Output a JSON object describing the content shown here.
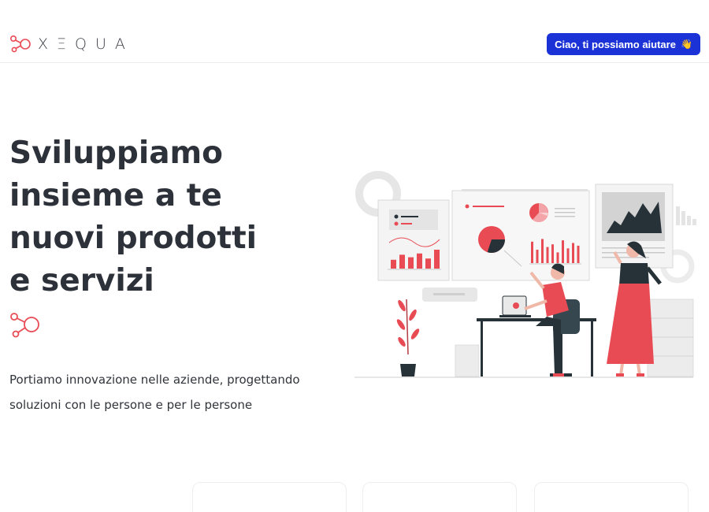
{
  "header": {
    "logo_text": "XΞQUA",
    "cta_label": "Ciao, ti possiamo aiutare",
    "cta_icon": "waving-hand-icon"
  },
  "hero": {
    "title_lines": [
      "Sviluppiamo",
      "insieme a te",
      "nuovi prodotti",
      "e servizi"
    ],
    "subtitle_lines": [
      "Portiamo innovazione nelle aziende, progettando",
      "soluzioni con le persone e per le persone"
    ],
    "icon": "molecule-icon"
  },
  "colors": {
    "accent": "#e94b54",
    "button": "#1b33d6",
    "text": "#2d323a",
    "dark": "#263238"
  },
  "illustration": {
    "name": "team-analytics-illustration",
    "bars_left": [
      0.35,
      0.55,
      0.45,
      0.6,
      0.4,
      0.75
    ],
    "bars_center": [
      0.8,
      0.5,
      0.9,
      0.6,
      0.7,
      0.4,
      0.85,
      0.55,
      0.75,
      0.65
    ],
    "pie_share": 0.7
  }
}
